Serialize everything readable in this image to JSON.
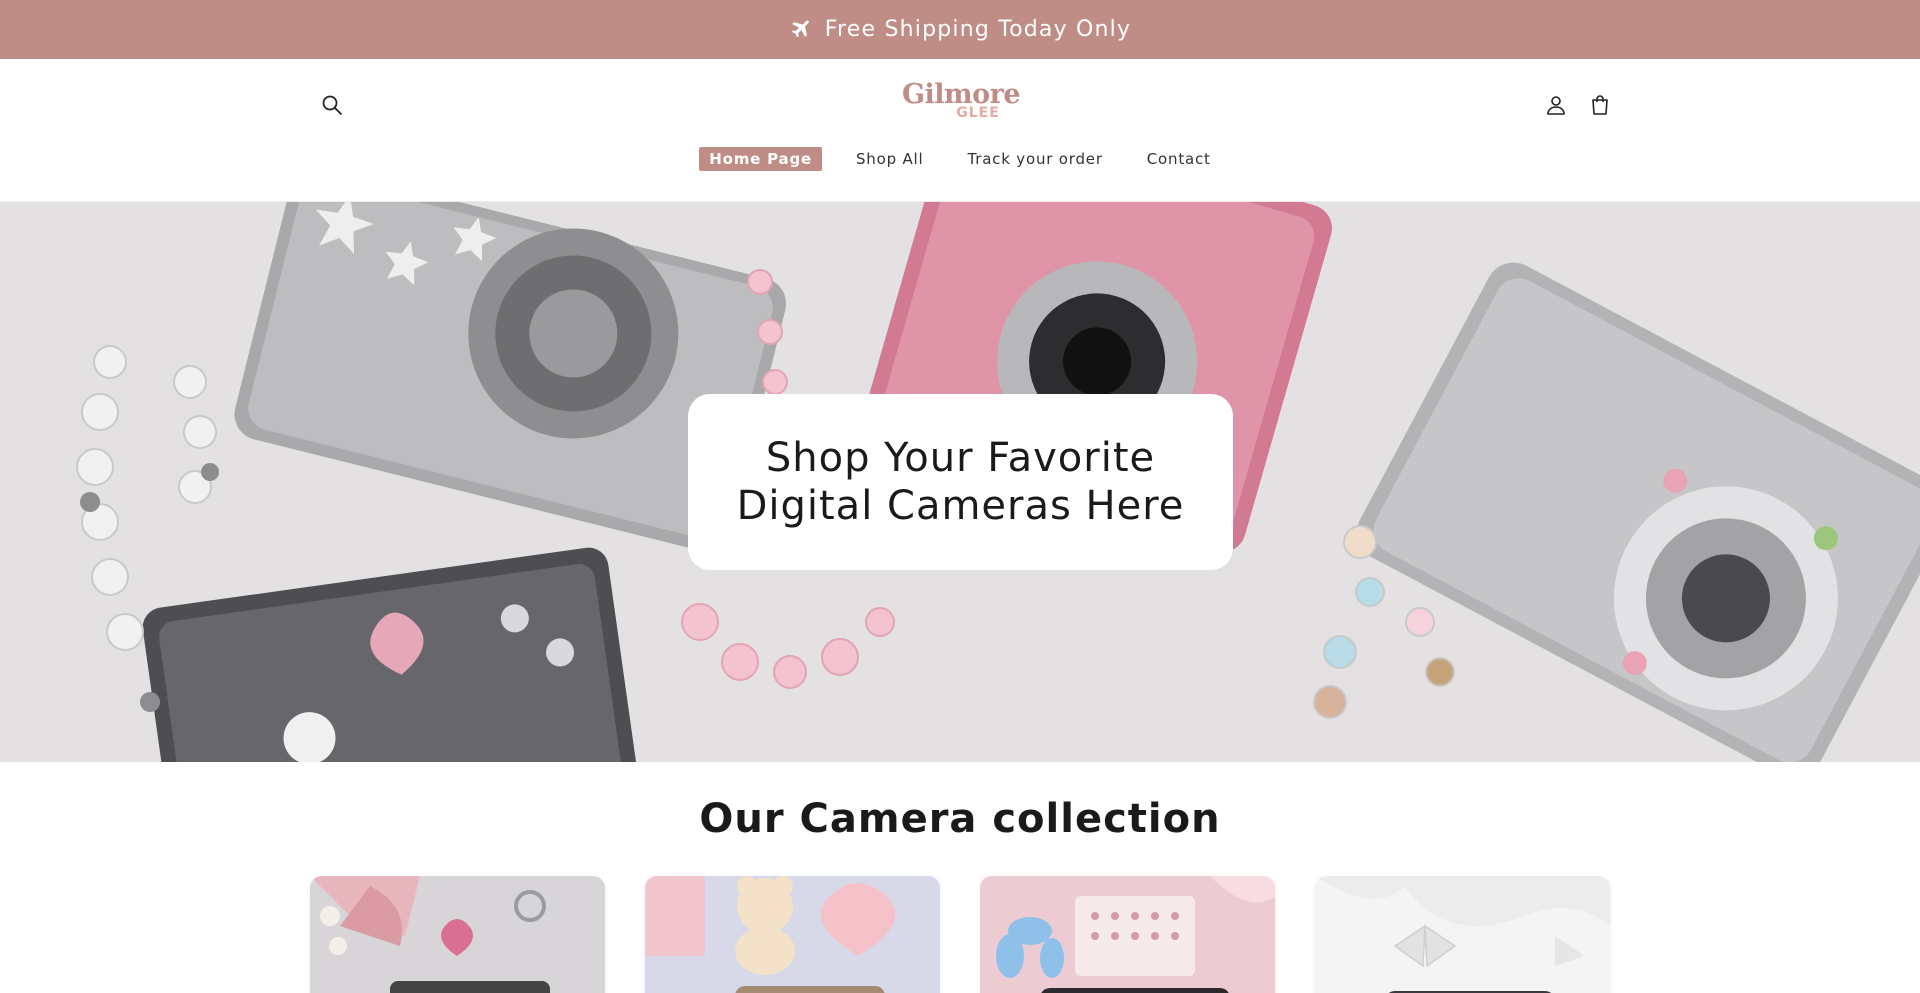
{
  "announcement": {
    "text": "Free Shipping Today Only",
    "icon": "airplane-icon"
  },
  "header": {
    "logo": {
      "line1": "Gilmore",
      "line2": "GLEE"
    },
    "icons": {
      "search": "search-icon",
      "account": "user-icon",
      "cart": "shopping-bag-icon"
    }
  },
  "nav": {
    "items": [
      {
        "label": "Home Page",
        "active": true
      },
      {
        "label": "Shop All",
        "active": false
      },
      {
        "label": "Track your order",
        "active": false
      },
      {
        "label": "Contact",
        "active": false
      }
    ]
  },
  "hero": {
    "heading": "Shop Your Favorite Digital Cameras Here"
  },
  "collection": {
    "title": "Our Camera collection",
    "cards": [
      {
        "image": "pink-bow-camera-keychain-photo"
      },
      {
        "image": "teddy-bear-heart-camera-photo"
      },
      {
        "image": "balloon-dog-sticker-camera-photo"
      },
      {
        "image": "white-bow-camera-photo"
      }
    ]
  },
  "colors": {
    "brand": "#c08c86",
    "brand_light": "#e7a9a4",
    "text": "#1a1a1a",
    "background": "#ffffff"
  }
}
